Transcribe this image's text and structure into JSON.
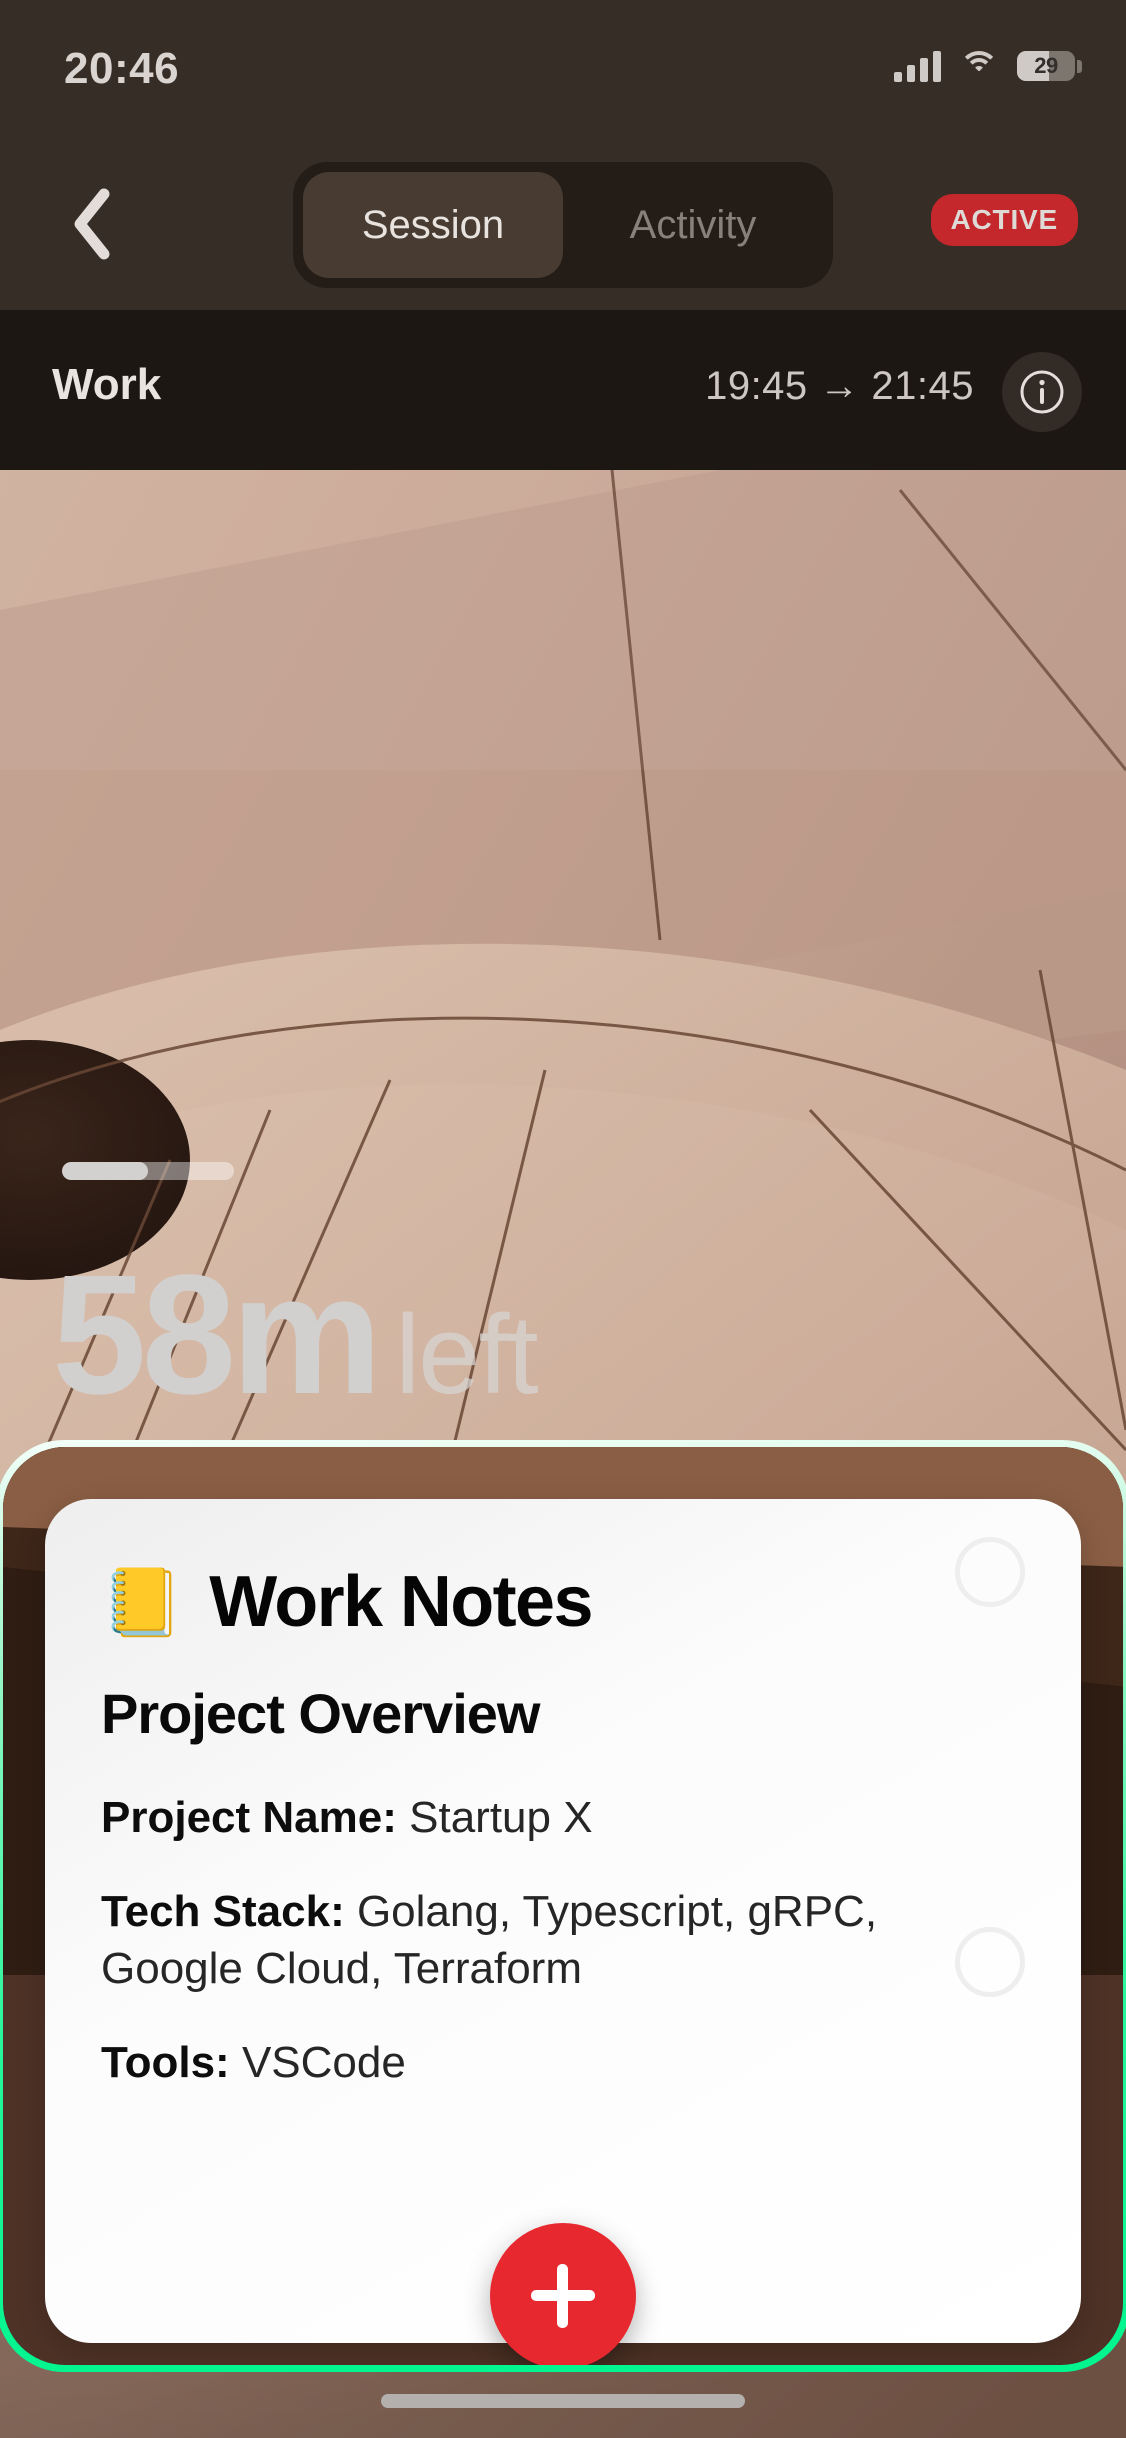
{
  "status_bar": {
    "time": "20:46",
    "battery_percent": "29",
    "cellular_icon": "cellular-signal-icon",
    "wifi_icon": "wifi-icon",
    "battery_icon": "battery-icon"
  },
  "nav_bar": {
    "back_icon": "chevron-left-icon",
    "tabs": [
      {
        "label": "Session",
        "selected": true
      },
      {
        "label": "Activity",
        "selected": false
      }
    ],
    "status_badge": "ACTIVE",
    "status_badge_color": "#c4282c"
  },
  "session_info": {
    "title": "Work",
    "time_range": "19:45 → 21:45",
    "start_time": "19:45",
    "end_time": "21:45",
    "info_icon": "info-circle-icon"
  },
  "timer": {
    "remaining_value": "58m",
    "remaining_suffix": "left",
    "progress_percent": 50
  },
  "sheet": {
    "border_color": "#00f58f",
    "note": {
      "emoji": "📒",
      "emoji_name": "ledger-notebook-icon",
      "title": "Work Notes",
      "section_heading": "Project Overview",
      "fields": [
        {
          "label": "Project Name:",
          "value": "Startup X"
        },
        {
          "label": "Tech Stack:",
          "value": "Golang, Typescript, gRPC, Google Cloud, Terraform"
        },
        {
          "label": "Tools:",
          "value": "VSCode"
        }
      ]
    },
    "add_button_icon": "plus-icon",
    "add_button_color": "#e8282f"
  },
  "home_indicator": "home-indicator"
}
